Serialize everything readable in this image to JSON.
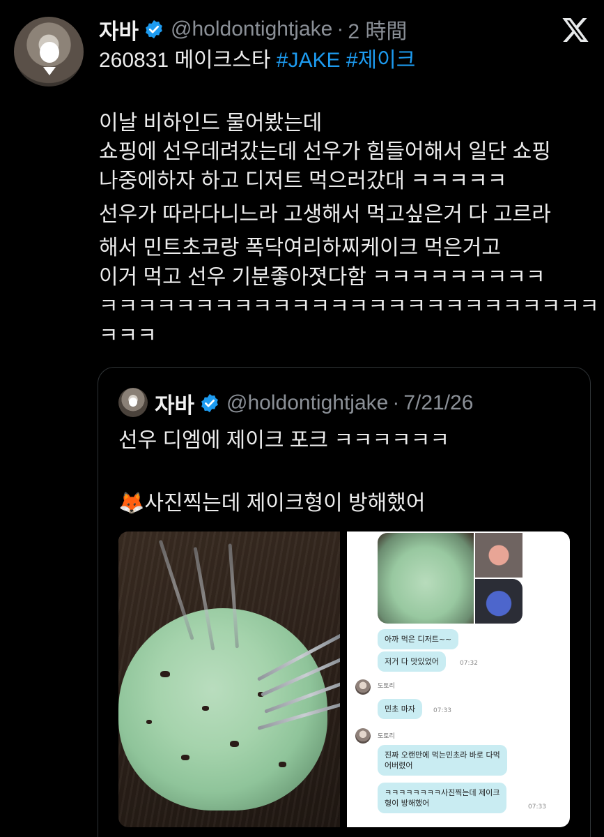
{
  "tweet": {
    "display_name": "자바",
    "handle": "@holdontightjake",
    "separator": "·",
    "time": "2 時間",
    "line1_text": "260831 메이크스타 ",
    "hashtags": [
      "#JAKE",
      "#제이크"
    ],
    "body_lines": [
      "이날 비하인드 물어봤는데",
      "쇼핑에 선우데려갔는데 선우가 힘들어해서 일단 쇼핑",
      "나중에하자 하고 디저트 먹으러갔대 ㅋㅋㅋㅋㅋ",
      "선우가 따라다니느라 고생해서 먹고싶은거 다 고르라",
      "해서 민트초코랑 폭닥여리하찌케이크 먹은거고",
      "이거 먹고 선우 기분좋아졋다함 ㅋㅋㅋㅋㅋㅋㅋㅋㅋ",
      "ㅋㅋㅋㅋㅋㅋㅋㅋㅋㅋㅋㅋㅋㅋㅋㅋㅋㅋㅋㅋㅋㅋㅋㅋㅋㅋ",
      "ㅋㅋㅋ"
    ]
  },
  "quoted": {
    "display_name": "자바",
    "handle": "@holdontightjake",
    "separator": "·",
    "time": "7/21/26",
    "line1": "선우 디엠에 제이크 포크 ㅋㅋㅋㅋㅋㅋ",
    "fox_emoji": "🦊",
    "line2": "사진찍는데 제이크형이 방해했어"
  },
  "chat": {
    "bubble1": "아까 먹은 디저트~~",
    "bubble2": "저거 다 맛있었어",
    "time1": "07:32",
    "sender": "도토리",
    "bubble3": "민초 마자",
    "time2": "07:33",
    "bubble4_line1": "진짜 오랜만에 먹는민초라 바로 다먹",
    "bubble4_line2": "어버렸어",
    "bubble5_line1": "ㅋㅋㅋㅋㅋㅋㅋㅋ사진찍는데 제이크",
    "bubble5_line2": "형이 방해했어",
    "time3": "07:33"
  },
  "icons": {
    "verified": "verified-badge-icon",
    "x_logo": "x-logo-icon"
  },
  "colors": {
    "background": "#000000",
    "hashtag": "#1d9bf0",
    "muted": "#8b9097",
    "chat_bubble": "#c9ecf2"
  }
}
